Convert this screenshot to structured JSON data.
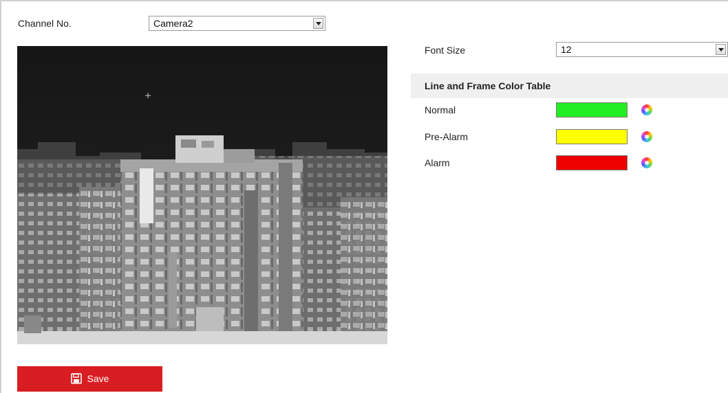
{
  "channel": {
    "label": "Channel No.",
    "value": "Camera2"
  },
  "font_size": {
    "label": "Font Size",
    "value": "12"
  },
  "color_table": {
    "title": "Line and Frame Color Table",
    "rows": [
      {
        "label": "Normal",
        "color": "#22ee22"
      },
      {
        "label": "Pre-Alarm",
        "color": "#ffff00"
      },
      {
        "label": "Alarm",
        "color": "#ee0000"
      }
    ]
  },
  "video": {
    "icon": "thermal-camera-preview"
  },
  "save": {
    "label": "Save",
    "icon": "floppy-disk-icon",
    "color": "#d81e22"
  }
}
